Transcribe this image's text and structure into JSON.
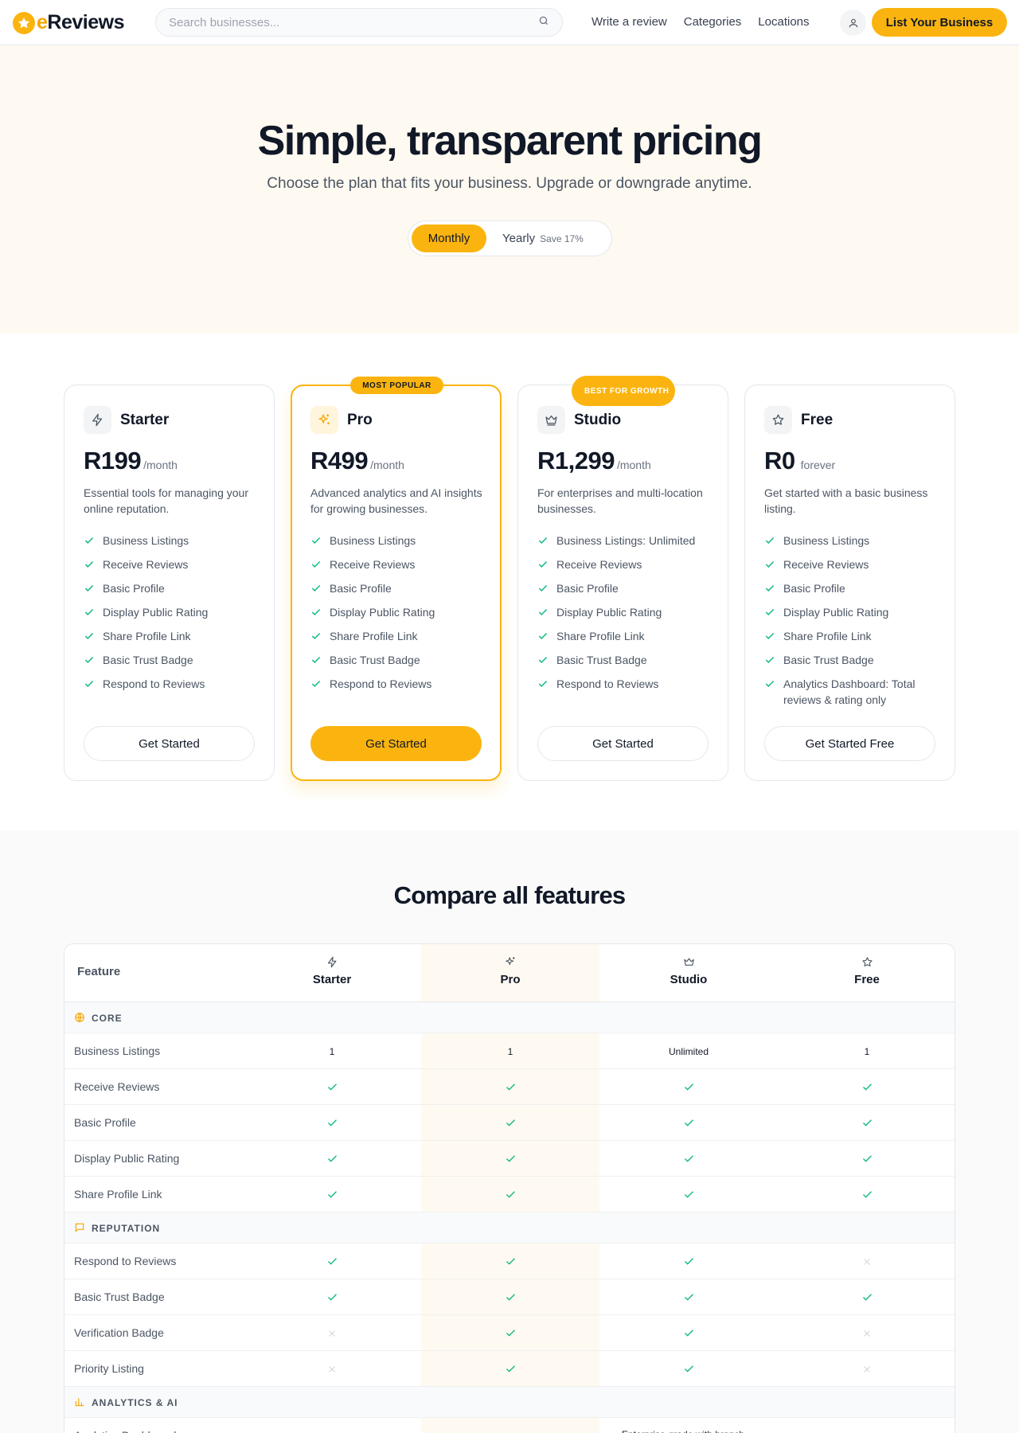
{
  "header": {
    "logo_prefix": "e",
    "logo_rest": "Reviews",
    "search_placeholder": "Search businesses...",
    "nav": [
      "Write a review",
      "Categories",
      "Locations"
    ],
    "cta": "List Your Business"
  },
  "hero": {
    "title": "Simple, transparent pricing",
    "subtitle": "Choose the plan that fits your business. Upgrade or downgrade anytime.",
    "toggle_monthly": "Monthly",
    "toggle_yearly": "Yearly",
    "toggle_save": "Save 17%"
  },
  "plans": [
    {
      "name": "Starter",
      "icon": "lightning-icon",
      "price": "R199",
      "period": "/month",
      "desc": "Essential tools for managing your online reputation.",
      "features": [
        "Business Listings",
        "Receive Reviews",
        "Basic Profile",
        "Display Public Rating",
        "Share Profile Link",
        "Basic Trust Badge",
        "Respond to Reviews"
      ],
      "cta": "Get Started"
    },
    {
      "name": "Pro",
      "icon": "sparkles-icon",
      "price": "R499",
      "period": "/month",
      "badge": "MOST POPULAR",
      "desc": "Advanced analytics and AI insights for growing businesses.",
      "features": [
        "Business Listings",
        "Receive Reviews",
        "Basic Profile",
        "Display Public Rating",
        "Share Profile Link",
        "Basic Trust Badge",
        "Respond to Reviews"
      ],
      "cta": "Get Started"
    },
    {
      "name": "Studio",
      "icon": "crown-icon",
      "price": "R1,299",
      "period": "/month",
      "badge": "BEST FOR GROWTH",
      "desc": "For enterprises and multi-location businesses.",
      "features": [
        "Business Listings: Unlimited",
        "Receive Reviews",
        "Basic Profile",
        "Display Public Rating",
        "Share Profile Link",
        "Basic Trust Badge",
        "Respond to Reviews"
      ],
      "cta": "Get Started"
    },
    {
      "name": "Free",
      "icon": "star-icon",
      "price": "R0",
      "period": "forever",
      "desc": "Get started with a basic business listing.",
      "features": [
        "Business Listings",
        "Receive Reviews",
        "Basic Profile",
        "Display Public Rating",
        "Share Profile Link",
        "Basic Trust Badge",
        "Analytics Dashboard: Total reviews & rating only"
      ],
      "cta": "Get Started Free"
    }
  ],
  "compare": {
    "title": "Compare all features",
    "feature_header": "Feature",
    "columns": [
      "Starter",
      "Pro",
      "Studio",
      "Free"
    ],
    "sections": [
      {
        "label": "CORE",
        "icon": "globe-icon",
        "rows": [
          {
            "name": "Business Listings",
            "values": [
              "1",
              "1",
              "Unlimited",
              "1"
            ]
          },
          {
            "name": "Receive Reviews",
            "values": [
              "check",
              "check",
              "check",
              "check"
            ]
          },
          {
            "name": "Basic Profile",
            "values": [
              "check",
              "check",
              "check",
              "check"
            ]
          },
          {
            "name": "Display Public Rating",
            "values": [
              "check",
              "check",
              "check",
              "check"
            ]
          },
          {
            "name": "Share Profile Link",
            "values": [
              "check",
              "check",
              "check",
              "check"
            ]
          }
        ]
      },
      {
        "label": "REPUTATION",
        "icon": "message-square-icon",
        "rows": [
          {
            "name": "Respond to Reviews",
            "values": [
              "check",
              "check",
              "check",
              "cross"
            ]
          },
          {
            "name": "Basic Trust Badge",
            "values": [
              "check",
              "check",
              "check",
              "check"
            ]
          },
          {
            "name": "Verification Badge",
            "values": [
              "cross",
              "check",
              "check",
              "cross"
            ]
          },
          {
            "name": "Priority Listing",
            "values": [
              "cross",
              "check",
              "check",
              "cross"
            ]
          }
        ]
      },
      {
        "label": "ANALYTICS & AI",
        "icon": "bar-chart-icon",
        "rows": [
          {
            "name": "Analytics Dashboard",
            "values": [
              "",
              "",
              "Enterprise-grade with branch",
              ""
            ]
          }
        ]
      }
    ]
  },
  "colors": {
    "accent": "#fbb40f",
    "check": "#10b981",
    "cross": "#d1d5db"
  }
}
